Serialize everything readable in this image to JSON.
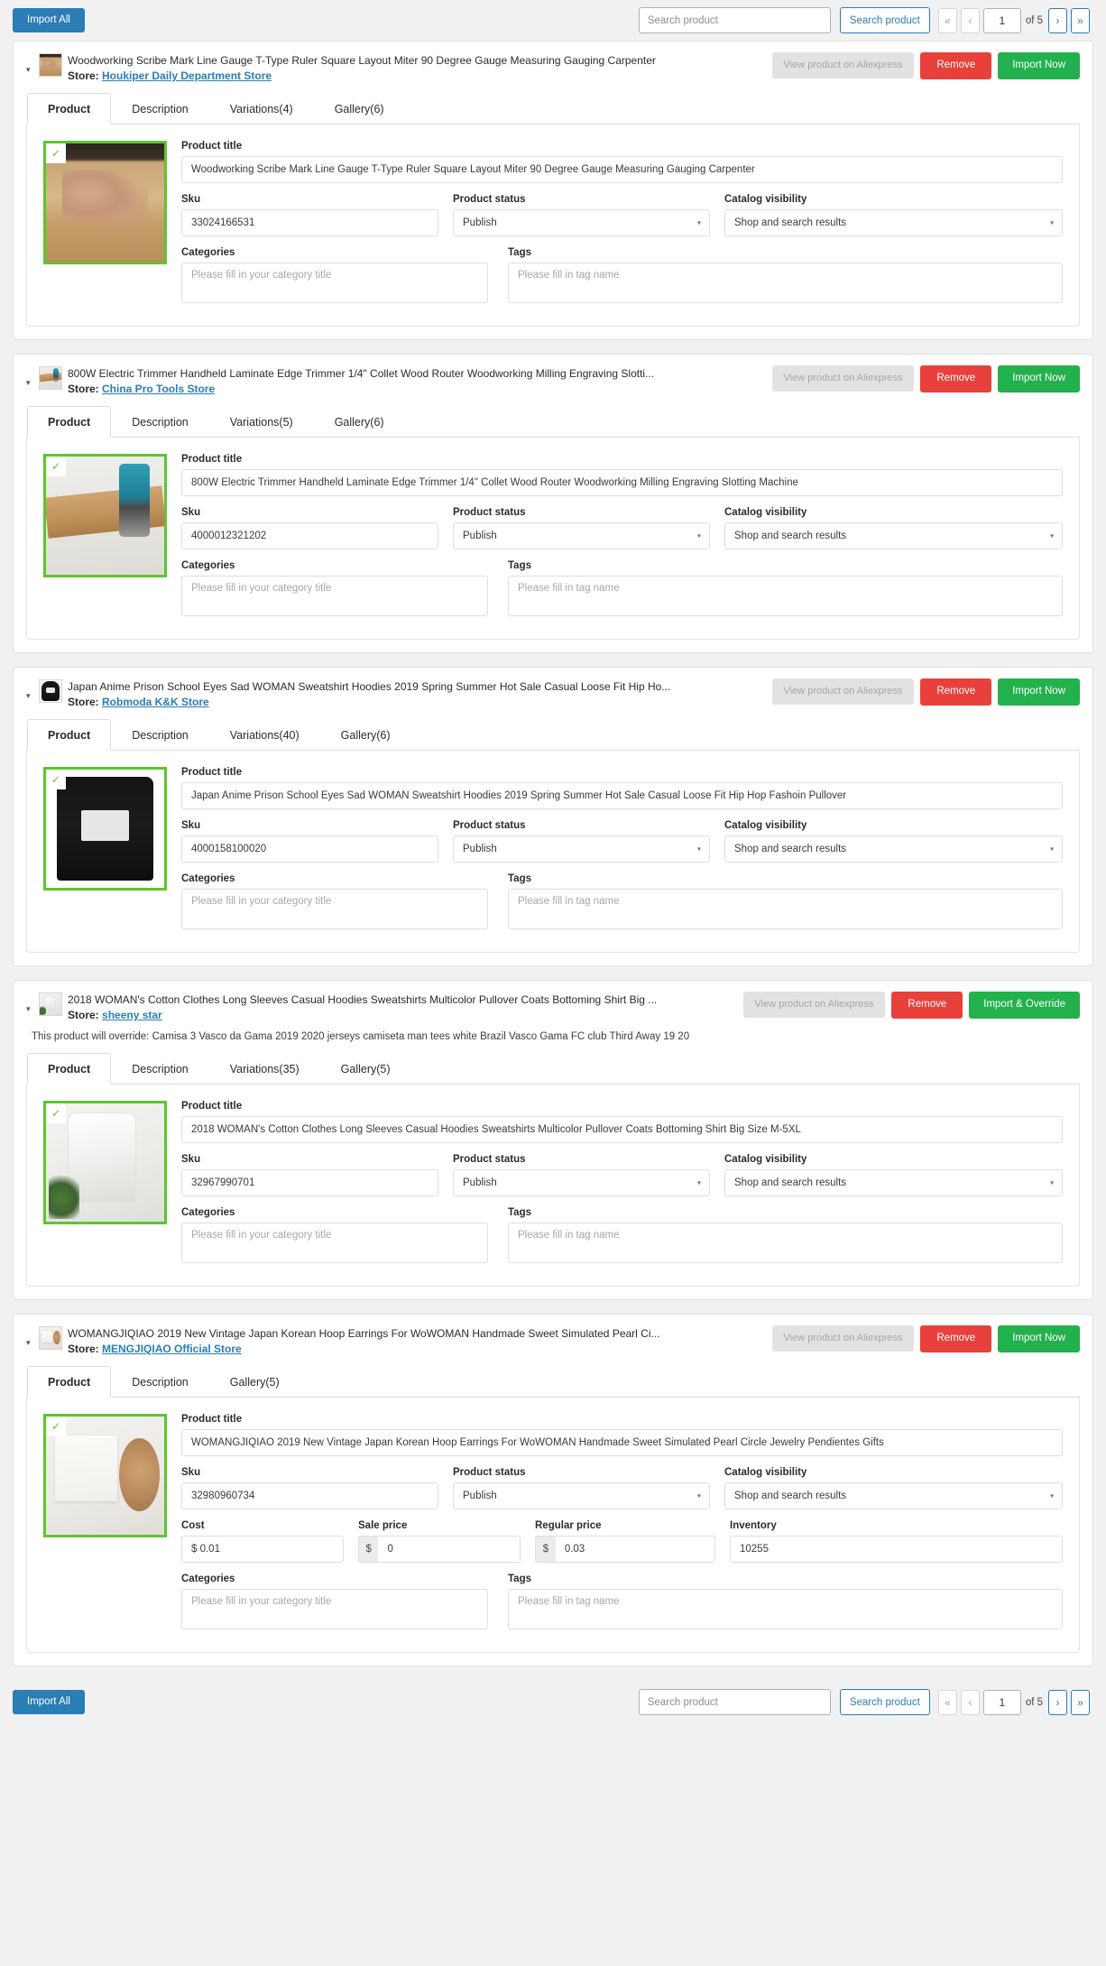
{
  "toolbar": {
    "import_all_label": "Import All",
    "search_placeholder": "Search product",
    "search_value": "",
    "search_button_label": "Search product",
    "first_label": "«",
    "prev_label": "‹",
    "next_label": "›",
    "last_label": "»",
    "page_value": "1",
    "of_label": "of 5"
  },
  "common": {
    "view_on_aliexpress_label": "View product on Aliexpress",
    "remove_label": "Remove",
    "store_prefix": "Store:",
    "caret_glyph": "▾",
    "check_glyph": "✓",
    "select_caret_glyph": "▾",
    "labels": {
      "product_title": "Product title",
      "sku": "Sku",
      "product_status": "Product status",
      "catalog_visibility": "Catalog visibility",
      "categories": "Categories",
      "tags": "Tags",
      "cost": "Cost",
      "sale_price": "Sale price",
      "regular_price": "Regular price",
      "inventory": "Inventory"
    },
    "placeholders": {
      "categories": "Please fill in your category title",
      "tags": "Please fill in tag name"
    },
    "currency_symbol": "$"
  },
  "products": [
    {
      "header_title": "Woodworking Scribe Mark Line Gauge T-Type Ruler Square Layout Miter 90 Degree Gauge Measuring Gauging Carpenter",
      "store_name": "Houkiper Daily Department Store",
      "import_label": "Import Now",
      "override_note": "",
      "thumb_class": "ph-wood",
      "tabs": [
        {
          "label": "Product",
          "active": true
        },
        {
          "label": "Description",
          "active": false
        },
        {
          "label": "Variations(4)",
          "active": false
        },
        {
          "label": "Gallery(6)",
          "active": false
        }
      ],
      "title_value": "Woodworking Scribe Mark Line Gauge T-Type Ruler Square Layout Miter 90 Degree Gauge Measuring Gauging Carpenter",
      "sku_value": "33024166531",
      "status_value": "Publish",
      "visibility_value": "Shop and search results",
      "categories_value": "",
      "tags_value": "",
      "has_pricing": false
    },
    {
      "header_title": "800W Electric Trimmer Handheld Laminate Edge Trimmer 1/4\" Collet Wood Router Woodworking Milling Engraving Slotti...",
      "store_name": "China Pro Tools Store",
      "import_label": "Import Now",
      "override_note": "",
      "thumb_class": "ph-wood2",
      "tabs": [
        {
          "label": "Product",
          "active": true
        },
        {
          "label": "Description",
          "active": false
        },
        {
          "label": "Variations(5)",
          "active": false
        },
        {
          "label": "Gallery(6)",
          "active": false
        }
      ],
      "title_value": "800W Electric Trimmer Handheld Laminate Edge Trimmer 1/4\" Collet Wood Router Woodworking Milling Engraving Slotting Machine",
      "sku_value": "4000012321202",
      "status_value": "Publish",
      "visibility_value": "Shop and search results",
      "categories_value": "",
      "tags_value": "",
      "has_pricing": false
    },
    {
      "header_title": "Japan Anime Prison School Eyes Sad WOMAN Sweatshirt Hoodies 2019 Spring Summer Hot Sale Casual Loose Fit Hip Ho...",
      "store_name": "Robmoda K&K Store",
      "import_label": "Import Now",
      "override_note": "",
      "thumb_class": "ph-hoodie",
      "tabs": [
        {
          "label": "Product",
          "active": true
        },
        {
          "label": "Description",
          "active": false
        },
        {
          "label": "Variations(40)",
          "active": false
        },
        {
          "label": "Gallery(6)",
          "active": false
        }
      ],
      "title_value": "Japan Anime Prison School Eyes Sad WOMAN Sweatshirt Hoodies 2019 Spring Summer Hot Sale Casual Loose Fit Hip Hop Fashoin Pullover",
      "sku_value": "4000158100020",
      "status_value": "Publish",
      "visibility_value": "Shop and search results",
      "categories_value": "",
      "tags_value": "",
      "has_pricing": false
    },
    {
      "header_title": "2018 WOMAN's Cotton Clothes Long Sleeves Casual Hoodies Sweatshirts Multicolor Pullover Coats Bottoming Shirt Big ...",
      "store_name": "sheeny star",
      "import_label": "Import & Override",
      "override_note": "This product will override: Camisa 3 Vasco da Gama 2019 2020 jerseys camiseta man tees white Brazil Vasco Gama FC club Third Away 19 20",
      "thumb_class": "ph-white",
      "tabs": [
        {
          "label": "Product",
          "active": true
        },
        {
          "label": "Description",
          "active": false
        },
        {
          "label": "Variations(35)",
          "active": false
        },
        {
          "label": "Gallery(5)",
          "active": false
        }
      ],
      "title_value": "2018 WOMAN's Cotton Clothes Long Sleeves Casual Hoodies Sweatshirts Multicolor Pullover Coats Bottoming Shirt Big Size M-5XL",
      "sku_value": "32967990701",
      "status_value": "Publish",
      "visibility_value": "Shop and search results",
      "categories_value": "",
      "tags_value": "",
      "has_pricing": false
    },
    {
      "header_title": "WOMANGJIQIAO 2019 New Vintage Japan Korean Hoop Earrings For WoWOMAN Handmade Sweet Simulated Pearl Ci...",
      "store_name": "MENGJIQIAO Official Store",
      "import_label": "Import Now",
      "override_note": "",
      "thumb_class": "ph-pearl",
      "tabs": [
        {
          "label": "Product",
          "active": true
        },
        {
          "label": "Description",
          "active": false
        },
        {
          "label": "Gallery(5)",
          "active": false
        }
      ],
      "title_value": "WOMANGJIQIAO 2019 New Vintage Japan Korean Hoop Earrings For WoWOMAN Handmade Sweet Simulated Pearl Circle Jewelry Pendientes Gifts",
      "sku_value": "32980960734",
      "status_value": "Publish",
      "visibility_value": "Shop and search results",
      "categories_value": "",
      "tags_value": "",
      "has_pricing": true,
      "cost_value": "$ 0.01",
      "sale_price_value": "0",
      "regular_price_value": "0.03",
      "inventory_value": "10255"
    }
  ],
  "colors": {
    "primary_blue": "#2a7db5",
    "danger_red": "#e8413c",
    "success_green": "#22b14c",
    "selection_green": "#5fc52e",
    "page_bg": "#f1f1f1"
  }
}
